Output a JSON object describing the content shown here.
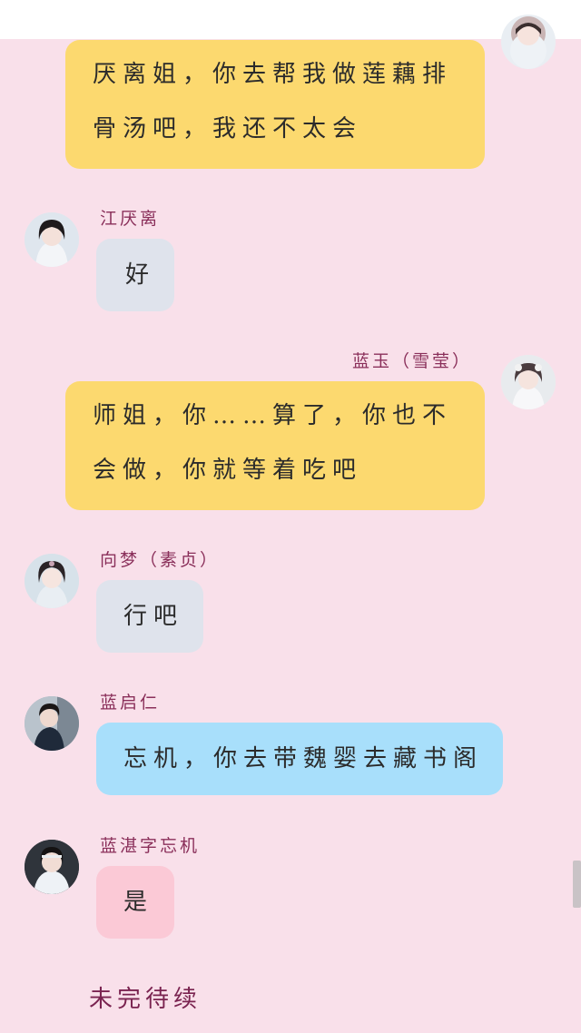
{
  "messages": [
    {
      "side": "right",
      "sender": "",
      "lines": [
        "厌离姐，你去帮我做莲藕排",
        "骨汤吧，我还不太会"
      ],
      "color": "#fcd96f"
    },
    {
      "side": "left",
      "sender": "江厌离",
      "lines": [
        "好"
      ],
      "color": "#dfe3ec"
    },
    {
      "side": "right",
      "sender": "蓝玉（雪莹）",
      "lines": [
        "师姐，你……算了，你也不",
        "会做，你就等着吃吧"
      ],
      "color": "#fcd96f"
    },
    {
      "side": "left",
      "sender": "向梦（素贞）",
      "lines": [
        "行吧"
      ],
      "color": "#dfe3ec"
    },
    {
      "side": "left",
      "sender": "蓝启仁",
      "lines": [
        "忘机，你去带魏婴去藏书阁"
      ],
      "color": "#a8dffb"
    },
    {
      "side": "left",
      "sender": "蓝湛字忘机",
      "lines": [
        "是"
      ],
      "color": "#fbc9d6"
    }
  ],
  "footer": "未完待续"
}
